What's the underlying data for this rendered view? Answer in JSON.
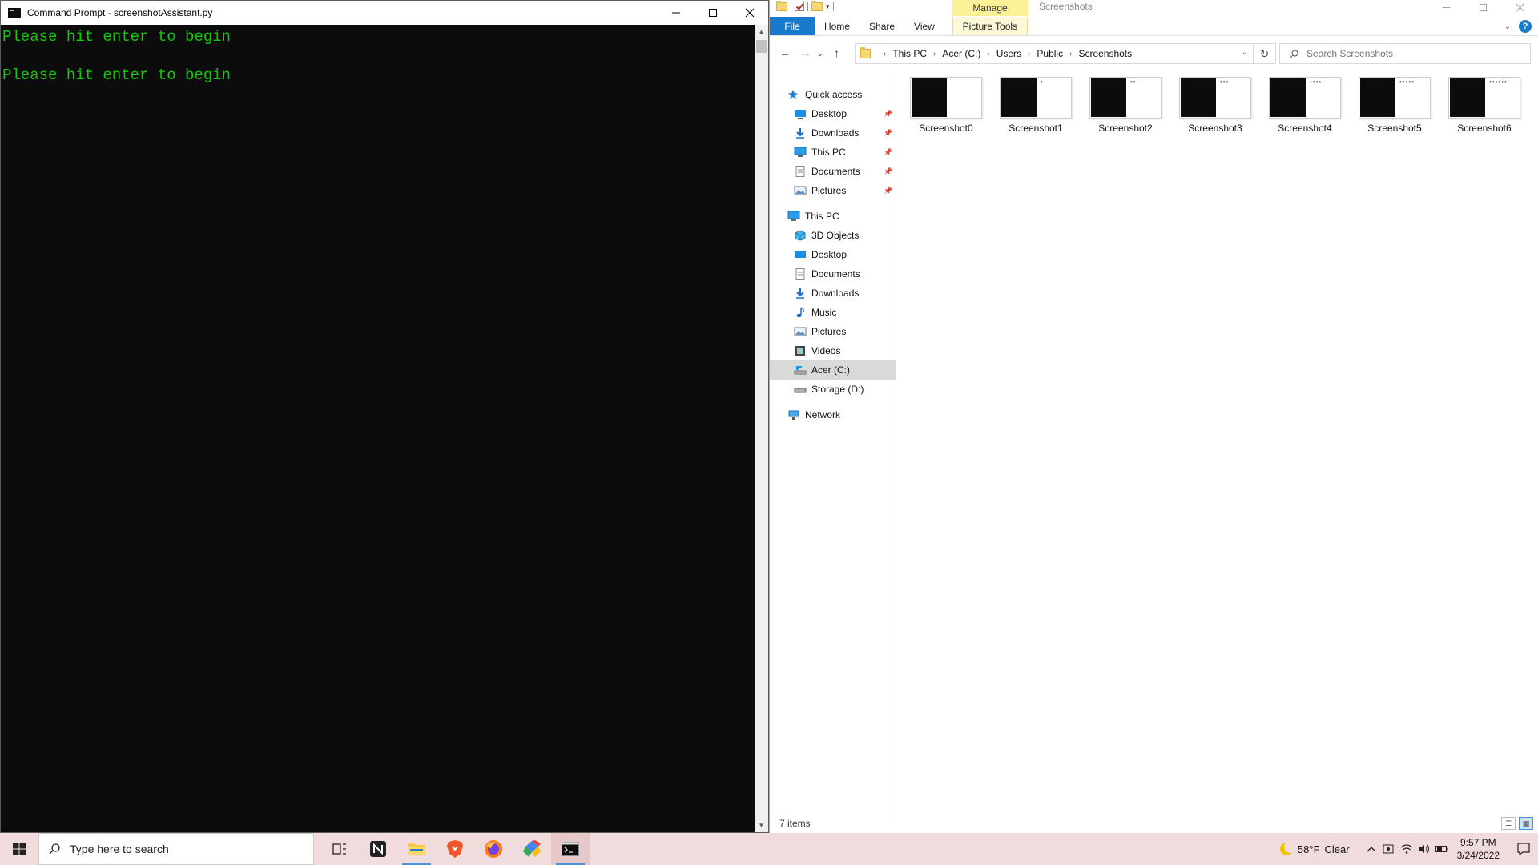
{
  "cmd": {
    "title": "Command Prompt - screenshotAssistant.py",
    "lines": [
      "Please hit enter to begin",
      "",
      "Please hit enter to begin"
    ]
  },
  "explorer": {
    "window_title": "Screenshots",
    "contextual_tab": "Manage",
    "ribbon_tabs": [
      "File",
      "Home",
      "Share",
      "View",
      "Picture Tools"
    ],
    "breadcrumb": [
      "This PC",
      "Acer (C:)",
      "Users",
      "Public",
      "Screenshots"
    ],
    "search_placeholder": "Search Screenshots",
    "nav": {
      "quick_access": "Quick access",
      "quick_items": [
        "Desktop",
        "Downloads",
        "This PC",
        "Documents",
        "Pictures"
      ],
      "this_pc": "This PC",
      "pc_items": [
        "3D Objects",
        "Desktop",
        "Documents",
        "Downloads",
        "Music",
        "Pictures",
        "Videos",
        "Acer (C:)",
        "Storage (D:)"
      ],
      "network": "Network",
      "selected": "Acer (C:)"
    },
    "files": [
      {
        "name": "Screenshot0",
        "dots": ""
      },
      {
        "name": "Screenshot1",
        "dots": "•"
      },
      {
        "name": "Screenshot2",
        "dots": "••"
      },
      {
        "name": "Screenshot3",
        "dots": "•••"
      },
      {
        "name": "Screenshot4",
        "dots": "••••"
      },
      {
        "name": "Screenshot5",
        "dots": "•••••"
      },
      {
        "name": "Screenshot6",
        "dots": "••••••"
      }
    ],
    "status": "7 items"
  },
  "taskbar": {
    "search_placeholder": "Type here to search",
    "weather_temp": "58°F",
    "weather_desc": "Clear",
    "time": "9:57 PM",
    "date": "3/24/2022",
    "apps": [
      "task-view",
      "notion",
      "file-explorer",
      "brave",
      "firefox",
      "google-cloud",
      "command-prompt"
    ]
  },
  "colors": {
    "console_text": "#16c60c",
    "console_bg": "#0c0c0c",
    "file_tab": "#1979ca",
    "manage_tab": "#fcf197",
    "taskbar": "#f0dcdc"
  }
}
